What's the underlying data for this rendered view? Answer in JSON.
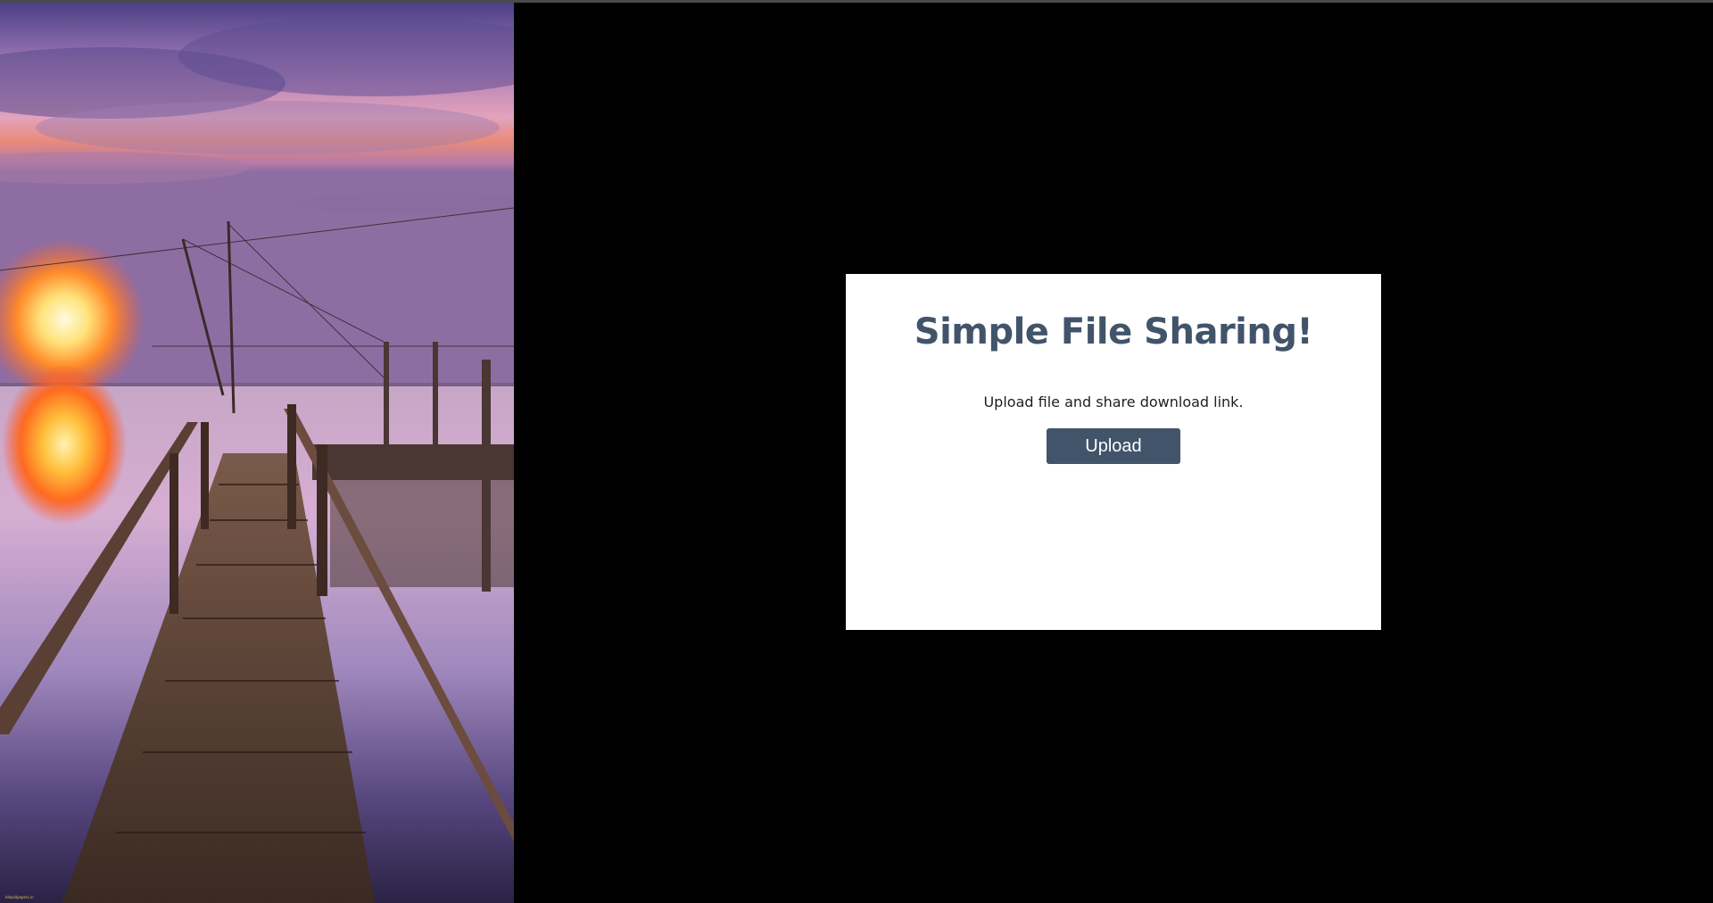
{
  "background": {
    "color": "#000000",
    "photo": {
      "description": "sunset-pier-photo",
      "watermark_text": "hdwallpapers.in"
    }
  },
  "card": {
    "title": "Simple File Sharing!",
    "subtitle": "Upload file and share download link.",
    "upload_label": "Upload"
  },
  "colors": {
    "accent": "#41546a",
    "card_bg": "#ffffff",
    "text": "#1f1f1f"
  }
}
